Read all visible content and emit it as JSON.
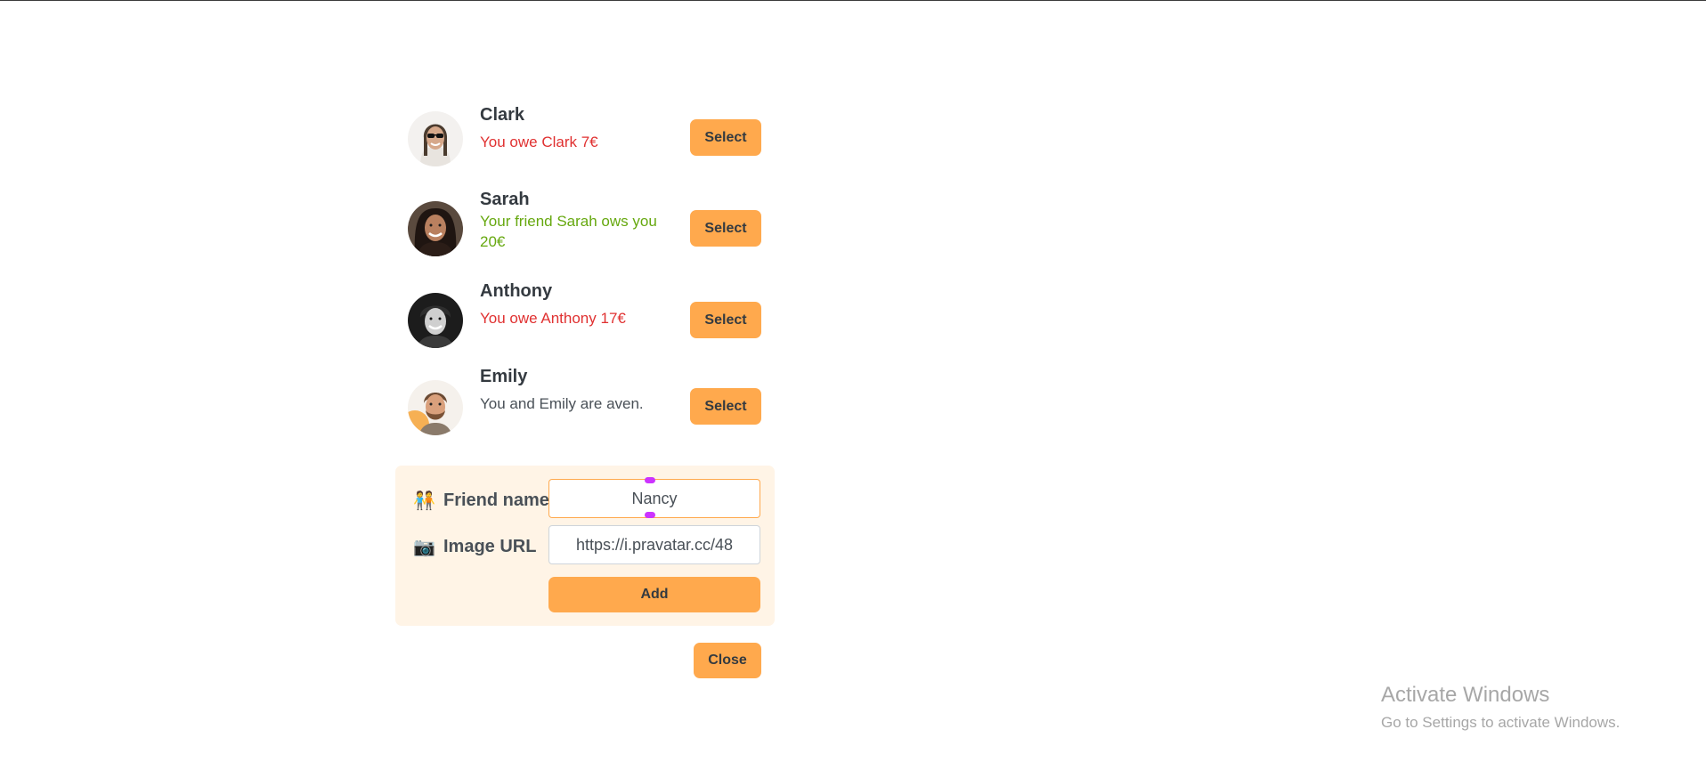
{
  "friends": [
    {
      "name": "Clark",
      "status": "You owe Clark 7€",
      "status_type": "owe",
      "select_label": "Select",
      "avatar_icon": "person-sunglasses-avatar"
    },
    {
      "name": "Sarah",
      "status": "Your friend Sarah ows you 20€",
      "status_type": "owed",
      "select_label": "Select",
      "avatar_icon": "person-smiling-avatar"
    },
    {
      "name": "Anthony",
      "status": "You owe Anthony 17€",
      "status_type": "owe",
      "select_label": "Select",
      "avatar_icon": "person-bw-avatar"
    },
    {
      "name": "Emily",
      "status": "You and Emily are aven.",
      "status_type": "even",
      "select_label": "Select",
      "avatar_icon": "person-beard-avatar"
    }
  ],
  "form": {
    "name_label": "Friend name",
    "name_emoji": "🧑‍🤝‍🧑",
    "name_value": "Nancy",
    "image_label": "Image URL",
    "image_emoji": "📷",
    "image_value": "https://i.pravatar.cc/48",
    "add_label": "Add"
  },
  "close_label": "Close",
  "watermark": {
    "title": "Activate Windows",
    "subtitle": "Go to Settings to activate Windows."
  },
  "colors": {
    "accent": "#ffa94d",
    "form_bg": "#fff4e6",
    "owe": "#e03131",
    "owed": "#66a80f",
    "text": "#495057"
  }
}
